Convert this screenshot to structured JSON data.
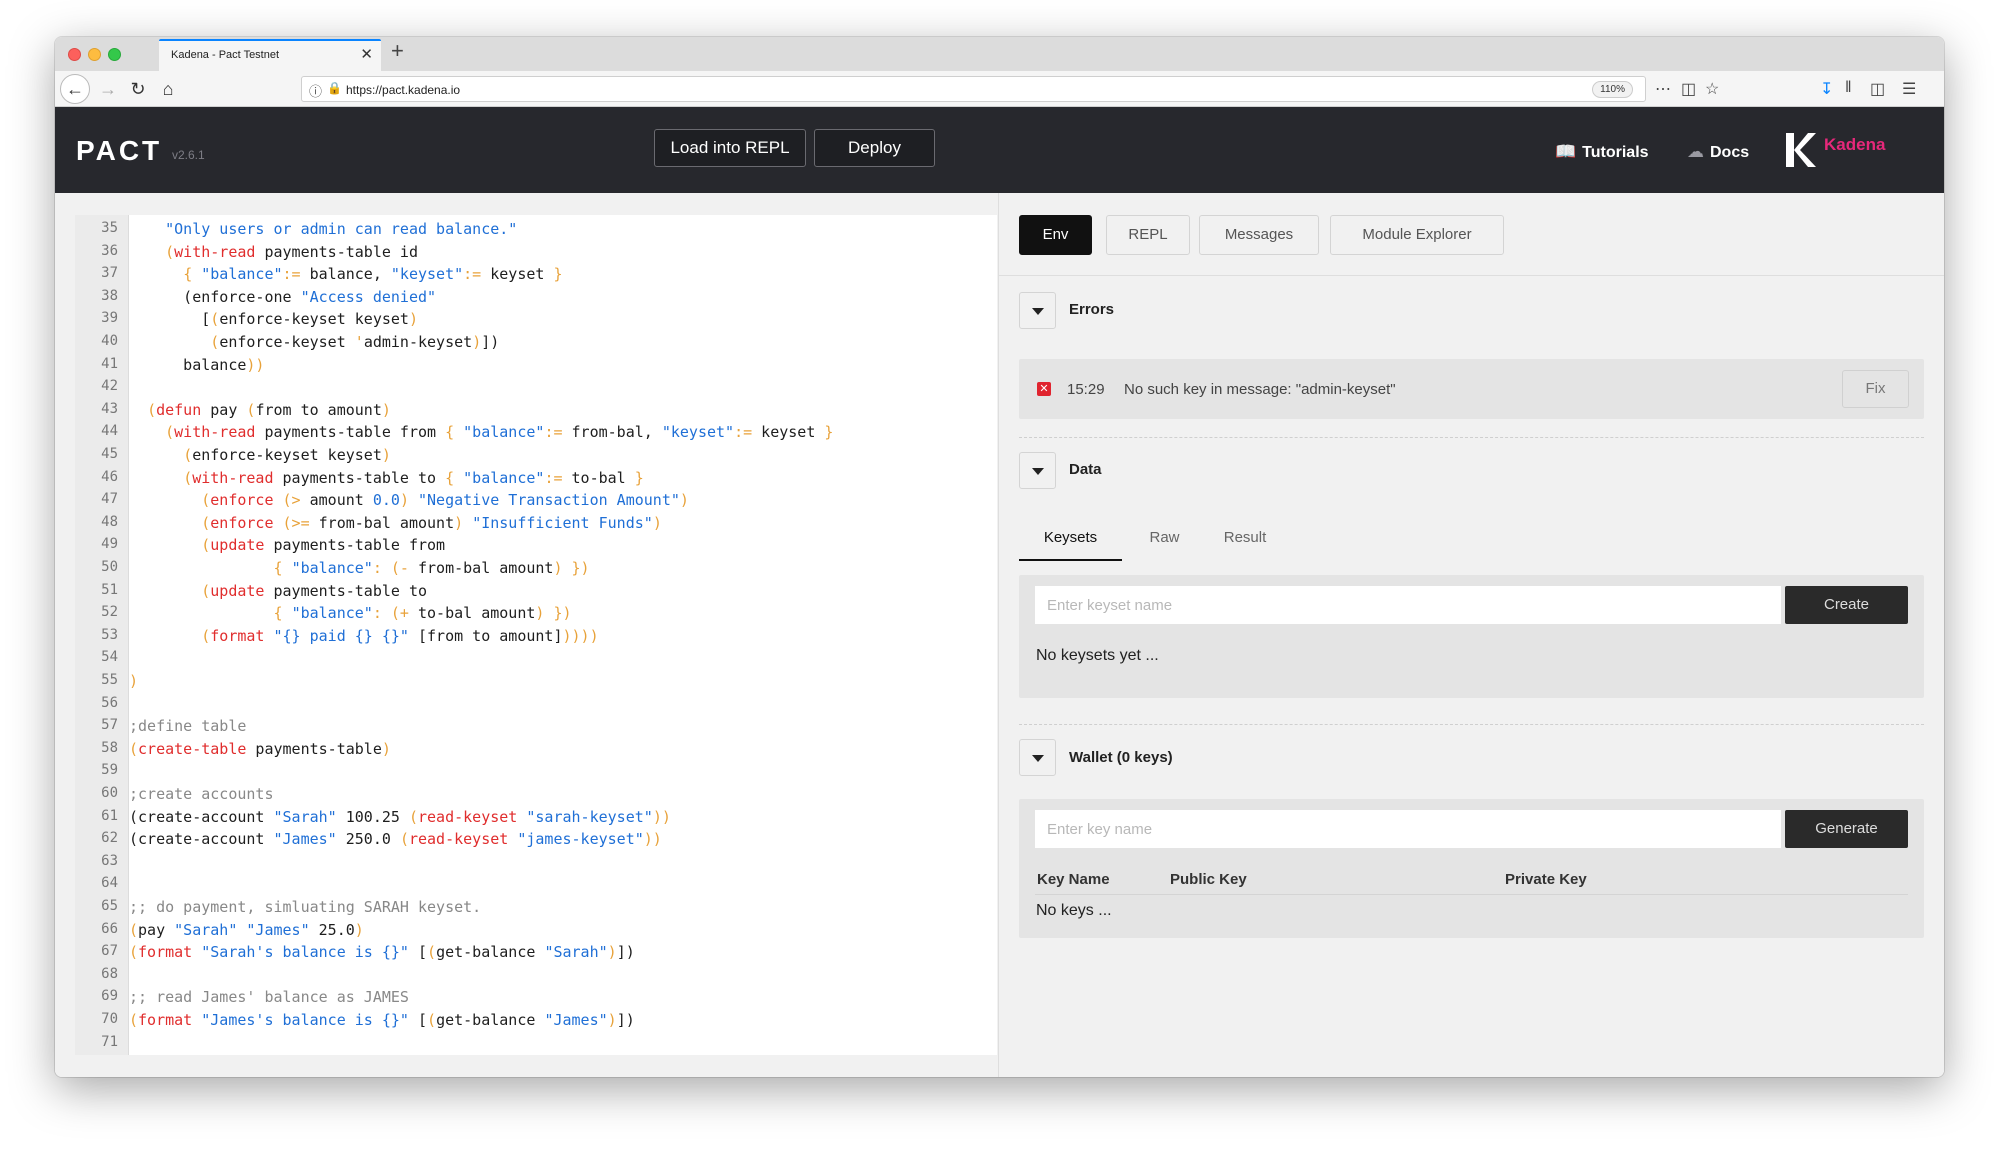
{
  "browser": {
    "tab_title": "Kadena - Pact Testnet",
    "tab_close": "✕",
    "new_tab": "+",
    "url": "https://pact.kadena.io",
    "zoom": "110%"
  },
  "header": {
    "logo": "PACT",
    "version": "v2.6.1",
    "load_button": "Load into REPL",
    "deploy_button": "Deploy",
    "tutorials": "Tutorials",
    "docs": "Docs",
    "brand": "Kadena"
  },
  "editor": {
    "line_numbers": [
      "35",
      "36",
      "37",
      "38",
      "39",
      "40",
      "41",
      "42",
      "43",
      "44",
      "45",
      "46",
      "47",
      "48",
      "49",
      "50",
      "51",
      "52",
      "53",
      "54",
      "55",
      "56",
      "57",
      "58",
      "59",
      "60",
      "61",
      "62",
      "63",
      "64",
      "65",
      "66",
      "67",
      "68",
      "69",
      "70",
      "71"
    ],
    "lines": [
      [
        {
          "t": "    \"Only users or admin can read balance.\"",
          "c": "#1f6fd6"
        }
      ],
      [
        {
          "t": "    ",
          "c": "#222"
        },
        {
          "t": "(",
          "c": "#e8a23a"
        },
        {
          "t": "with-read",
          "c": "#e02d2d"
        },
        {
          "t": " payments-table id",
          "c": "#1e1e1e"
        }
      ],
      [
        {
          "t": "      ",
          "c": "#222"
        },
        {
          "t": "{ ",
          "c": "#e8a23a"
        },
        {
          "t": "\"balance\"",
          "c": "#1f6fd6"
        },
        {
          "t": ":=",
          "c": "#e8a23a"
        },
        {
          "t": " balance, ",
          "c": "#1e1e1e"
        },
        {
          "t": "\"keyset\"",
          "c": "#1f6fd6"
        },
        {
          "t": ":=",
          "c": "#e8a23a"
        },
        {
          "t": " keyset ",
          "c": "#1e1e1e"
        },
        {
          "t": "}",
          "c": "#e8a23a"
        }
      ],
      [
        {
          "t": "      (enforce-one ",
          "c": "#1e1e1e"
        },
        {
          "t": "\"Access denied\"",
          "c": "#1f6fd6"
        }
      ],
      [
        {
          "t": "        [",
          "c": "#1e1e1e"
        },
        {
          "t": "(",
          "c": "#e8a23a"
        },
        {
          "t": "enforce-keyset keyset",
          "c": "#1e1e1e"
        },
        {
          "t": ")",
          "c": "#e8a23a"
        }
      ],
      [
        {
          "t": "         ",
          "c": "#222"
        },
        {
          "t": "(",
          "c": "#e8a23a"
        },
        {
          "t": "enforce-keyset ",
          "c": "#1e1e1e"
        },
        {
          "t": "'",
          "c": "#e8a23a"
        },
        {
          "t": "admin-keyset",
          "c": "#1e1e1e"
        },
        {
          "t": ")",
          "c": "#e8a23a"
        },
        {
          "t": "])",
          "c": "#1e1e1e"
        }
      ],
      [
        {
          "t": "      balance",
          "c": "#1e1e1e"
        },
        {
          "t": "))",
          "c": "#e8a23a"
        }
      ],
      [
        {
          "t": "",
          "c": "#1e1e1e"
        }
      ],
      [
        {
          "t": "  ",
          "c": "#222"
        },
        {
          "t": "(",
          "c": "#e8a23a"
        },
        {
          "t": "defun",
          "c": "#e02d2d"
        },
        {
          "t": " pay ",
          "c": "#1e1e1e"
        },
        {
          "t": "(",
          "c": "#e8a23a"
        },
        {
          "t": "from to amount",
          "c": "#1e1e1e"
        },
        {
          "t": ")",
          "c": "#e8a23a"
        }
      ],
      [
        {
          "t": "    ",
          "c": "#222"
        },
        {
          "t": "(",
          "c": "#e8a23a"
        },
        {
          "t": "with-read",
          "c": "#e02d2d"
        },
        {
          "t": " payments-table from ",
          "c": "#1e1e1e"
        },
        {
          "t": "{ ",
          "c": "#e8a23a"
        },
        {
          "t": "\"balance\"",
          "c": "#1f6fd6"
        },
        {
          "t": ":=",
          "c": "#e8a23a"
        },
        {
          "t": " from-bal, ",
          "c": "#1e1e1e"
        },
        {
          "t": "\"keyset\"",
          "c": "#1f6fd6"
        },
        {
          "t": ":=",
          "c": "#e8a23a"
        },
        {
          "t": " keyset ",
          "c": "#1e1e1e"
        },
        {
          "t": "}",
          "c": "#e8a23a"
        }
      ],
      [
        {
          "t": "      ",
          "c": "#222"
        },
        {
          "t": "(",
          "c": "#e8a23a"
        },
        {
          "t": "enforce-keyset keyset",
          "c": "#1e1e1e"
        },
        {
          "t": ")",
          "c": "#e8a23a"
        }
      ],
      [
        {
          "t": "      ",
          "c": "#222"
        },
        {
          "t": "(",
          "c": "#e8a23a"
        },
        {
          "t": "with-read",
          "c": "#e02d2d"
        },
        {
          "t": " payments-table to ",
          "c": "#1e1e1e"
        },
        {
          "t": "{ ",
          "c": "#e8a23a"
        },
        {
          "t": "\"balance\"",
          "c": "#1f6fd6"
        },
        {
          "t": ":=",
          "c": "#e8a23a"
        },
        {
          "t": " to-bal ",
          "c": "#1e1e1e"
        },
        {
          "t": "}",
          "c": "#e8a23a"
        }
      ],
      [
        {
          "t": "        ",
          "c": "#222"
        },
        {
          "t": "(",
          "c": "#e8a23a"
        },
        {
          "t": "enforce",
          "c": "#e02d2d"
        },
        {
          "t": " (> ",
          "c": "#e8a23a"
        },
        {
          "t": "amount ",
          "c": "#1e1e1e"
        },
        {
          "t": "0.0",
          "c": "#1f6fd6"
        },
        {
          "t": ") ",
          "c": "#e8a23a"
        },
        {
          "t": "\"Negative Transaction Amount\"",
          "c": "#1f6fd6"
        },
        {
          "t": ")",
          "c": "#e8a23a"
        }
      ],
      [
        {
          "t": "        ",
          "c": "#222"
        },
        {
          "t": "(",
          "c": "#e8a23a"
        },
        {
          "t": "enforce",
          "c": "#e02d2d"
        },
        {
          "t": " (>= ",
          "c": "#e8a23a"
        },
        {
          "t": "from-bal amount",
          "c": "#1e1e1e"
        },
        {
          "t": ") ",
          "c": "#e8a23a"
        },
        {
          "t": "\"Insufficient Funds\"",
          "c": "#1f6fd6"
        },
        {
          "t": ")",
          "c": "#e8a23a"
        }
      ],
      [
        {
          "t": "        ",
          "c": "#222"
        },
        {
          "t": "(",
          "c": "#e8a23a"
        },
        {
          "t": "update",
          "c": "#e02d2d"
        },
        {
          "t": " payments-table from",
          "c": "#1e1e1e"
        }
      ],
      [
        {
          "t": "                ",
          "c": "#222"
        },
        {
          "t": "{ ",
          "c": "#e8a23a"
        },
        {
          "t": "\"balance\"",
          "c": "#1f6fd6"
        },
        {
          "t": ": (- ",
          "c": "#e8a23a"
        },
        {
          "t": "from-bal amount",
          "c": "#1e1e1e"
        },
        {
          "t": ") })",
          "c": "#e8a23a"
        }
      ],
      [
        {
          "t": "        ",
          "c": "#222"
        },
        {
          "t": "(",
          "c": "#e8a23a"
        },
        {
          "t": "update",
          "c": "#e02d2d"
        },
        {
          "t": " payments-table to",
          "c": "#1e1e1e"
        }
      ],
      [
        {
          "t": "                ",
          "c": "#222"
        },
        {
          "t": "{ ",
          "c": "#e8a23a"
        },
        {
          "t": "\"balance\"",
          "c": "#1f6fd6"
        },
        {
          "t": ": (+ ",
          "c": "#e8a23a"
        },
        {
          "t": "to-bal amount",
          "c": "#1e1e1e"
        },
        {
          "t": ") })",
          "c": "#e8a23a"
        }
      ],
      [
        {
          "t": "        ",
          "c": "#222"
        },
        {
          "t": "(",
          "c": "#e8a23a"
        },
        {
          "t": "format",
          "c": "#e02d2d"
        },
        {
          "t": " \"{} paid {} {}\"",
          "c": "#1f6fd6"
        },
        {
          "t": " [from to amount]",
          "c": "#1e1e1e"
        },
        {
          "t": "))))",
          "c": "#e8a23a"
        }
      ],
      [
        {
          "t": "",
          "c": "#1e1e1e"
        }
      ],
      [
        {
          "t": ")",
          "c": "#e8a23a"
        }
      ],
      [
        {
          "t": "",
          "c": "#1e1e1e"
        }
      ],
      [
        {
          "t": ";define table",
          "c": "#888888"
        }
      ],
      [
        {
          "t": "(",
          "c": "#e8a23a"
        },
        {
          "t": "create-table",
          "c": "#e02d2d"
        },
        {
          "t": " payments-table",
          "c": "#1e1e1e"
        },
        {
          "t": ")",
          "c": "#e8a23a"
        }
      ],
      [
        {
          "t": "",
          "c": "#1e1e1e"
        }
      ],
      [
        {
          "t": ";create accounts",
          "c": "#888888"
        }
      ],
      [
        {
          "t": "(create-account ",
          "c": "#1e1e1e"
        },
        {
          "t": "\"Sarah\"",
          "c": "#1f6fd6"
        },
        {
          "t": " 100.25 ",
          "c": "#1e1e1e"
        },
        {
          "t": "(",
          "c": "#e8a23a"
        },
        {
          "t": "read-keyset",
          "c": "#e02d2d"
        },
        {
          "t": " \"sarah-keyset\"",
          "c": "#1f6fd6"
        },
        {
          "t": "))",
          "c": "#e8a23a"
        }
      ],
      [
        {
          "t": "(create-account ",
          "c": "#1e1e1e"
        },
        {
          "t": "\"James\"",
          "c": "#1f6fd6"
        },
        {
          "t": " 250.0 ",
          "c": "#1e1e1e"
        },
        {
          "t": "(",
          "c": "#e8a23a"
        },
        {
          "t": "read-keyset",
          "c": "#e02d2d"
        },
        {
          "t": " \"james-keyset\"",
          "c": "#1f6fd6"
        },
        {
          "t": "))",
          "c": "#e8a23a"
        }
      ],
      [
        {
          "t": "",
          "c": "#1e1e1e"
        }
      ],
      [
        {
          "t": "",
          "c": "#1e1e1e"
        }
      ],
      [
        {
          "t": ";; do payment, simluating SARAH keyset.",
          "c": "#888888"
        }
      ],
      [
        {
          "t": "(",
          "c": "#e8a23a"
        },
        {
          "t": "pay ",
          "c": "#1e1e1e"
        },
        {
          "t": "\"Sarah\" \"James\"",
          "c": "#1f6fd6"
        },
        {
          "t": " 25.0",
          "c": "#1e1e1e"
        },
        {
          "t": ")",
          "c": "#e8a23a"
        }
      ],
      [
        {
          "t": "(",
          "c": "#e8a23a"
        },
        {
          "t": "format",
          "c": "#e02d2d"
        },
        {
          "t": " \"Sarah's balance is {}\"",
          "c": "#1f6fd6"
        },
        {
          "t": " [",
          "c": "#1e1e1e"
        },
        {
          "t": "(",
          "c": "#e8a23a"
        },
        {
          "t": "get-balance ",
          "c": "#1e1e1e"
        },
        {
          "t": "\"Sarah\"",
          "c": "#1f6fd6"
        },
        {
          "t": ")",
          "c": "#e8a23a"
        },
        {
          "t": "])",
          "c": "#1e1e1e"
        }
      ],
      [
        {
          "t": "",
          "c": "#1e1e1e"
        }
      ],
      [
        {
          "t": ";; read James' balance as JAMES",
          "c": "#888888"
        }
      ],
      [
        {
          "t": "(",
          "c": "#e8a23a"
        },
        {
          "t": "format",
          "c": "#e02d2d"
        },
        {
          "t": " \"James's balance is {}\"",
          "c": "#1f6fd6"
        },
        {
          "t": " [",
          "c": "#1e1e1e"
        },
        {
          "t": "(",
          "c": "#e8a23a"
        },
        {
          "t": "get-balance ",
          "c": "#1e1e1e"
        },
        {
          "t": "\"James\"",
          "c": "#1f6fd6"
        },
        {
          "t": ")",
          "c": "#e8a23a"
        },
        {
          "t": "])",
          "c": "#1e1e1e"
        }
      ],
      [
        {
          "t": "",
          "c": "#1e1e1e"
        }
      ]
    ]
  },
  "panel": {
    "tabs": [
      "Env",
      "REPL",
      "Messages",
      "Module Explorer"
    ],
    "active_tab": "Env",
    "errors": {
      "title": "Errors",
      "time": "15:29",
      "message": "No such key in message: \"admin-keyset\"",
      "fix": "Fix"
    },
    "data": {
      "title": "Data",
      "subtabs": [
        "Keysets",
        "Raw",
        "Result"
      ],
      "keyset_placeholder": "Enter keyset name",
      "create": "Create",
      "empty": "No keysets yet ..."
    },
    "wallet": {
      "title": "Wallet (0 keys)",
      "key_placeholder": "Enter key name",
      "generate": "Generate",
      "columns": [
        "Key Name",
        "Public Key",
        "Private Key"
      ],
      "empty": "No keys ..."
    }
  }
}
